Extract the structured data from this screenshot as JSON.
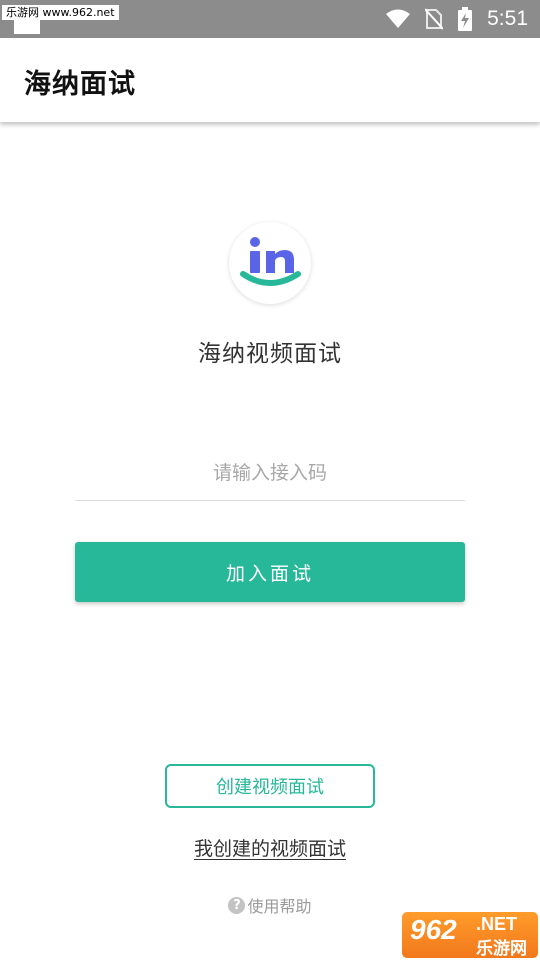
{
  "status_bar": {
    "watermark": "乐游网 www.962.net",
    "time": "5:51",
    "icons": [
      "wifi-icon",
      "no-sim-icon",
      "battery-charging-icon"
    ]
  },
  "app_bar": {
    "title": "海纳面试"
  },
  "brand": {
    "logo_text": "in",
    "name": "海纳视频面试",
    "colors": {
      "logo_blue": "#5a64e6",
      "accent_green": "#27b899"
    }
  },
  "join_form": {
    "code_input": {
      "placeholder": "请输入接入码",
      "value": ""
    },
    "join_button_label": "加入面试"
  },
  "actions": {
    "create_button_label": "创建视频面试",
    "my_interviews_link": "我创建的视频面试",
    "help_icon": "?",
    "help_label": "使用帮助"
  },
  "watermark_logo": {
    "number": "962",
    "domain": ".NET",
    "site_name": "乐游网"
  }
}
